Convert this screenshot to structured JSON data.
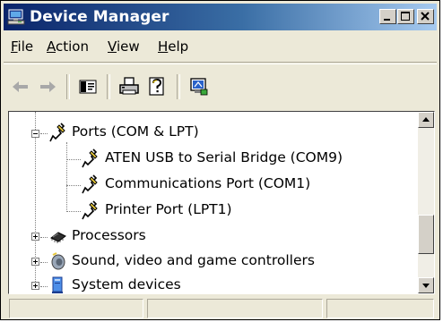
{
  "window": {
    "title": "Device Manager",
    "title_icon": "computer-monitor-icon"
  },
  "caption_buttons": [
    "minimize-icon",
    "maximize-icon",
    "close-icon"
  ],
  "menu": {
    "items": [
      {
        "accel": "F",
        "rest": "ile"
      },
      {
        "accel": "A",
        "rest": "ction"
      },
      {
        "accel": "V",
        "rest": "iew"
      },
      {
        "accel": "H",
        "rest": "elp"
      }
    ]
  },
  "toolbar": {
    "buttons": [
      "back-arrow-icon",
      "forward-arrow-icon",
      "properties-sheet-icon",
      "print-icon",
      "help-icon",
      "scan-hardware-icon"
    ]
  },
  "tree": {
    "ports": {
      "label": "Ports (COM & LPT)",
      "icon": "port-plug-icon",
      "expanded": true
    },
    "port_children": [
      {
        "label": "ATEN USB to Serial Bridge (COM9)",
        "icon": "port-plug-icon"
      },
      {
        "label": "Communications Port (COM1)",
        "icon": "port-plug-icon"
      },
      {
        "label": "Printer Port (LPT1)",
        "icon": "port-plug-icon"
      }
    ],
    "processors": {
      "label": "Processors",
      "icon": "processor-chip-icon",
      "expanded": false
    },
    "sound": {
      "label": "Sound, video and game controllers",
      "icon": "speaker-icon",
      "expanded": false
    },
    "system": {
      "label": "System devices",
      "icon": "system-computer-icon",
      "expanded": false
    }
  },
  "colors": {
    "title_start": "#0a246a",
    "title_end": "#a6caf0",
    "chrome": "#ece9d8"
  }
}
